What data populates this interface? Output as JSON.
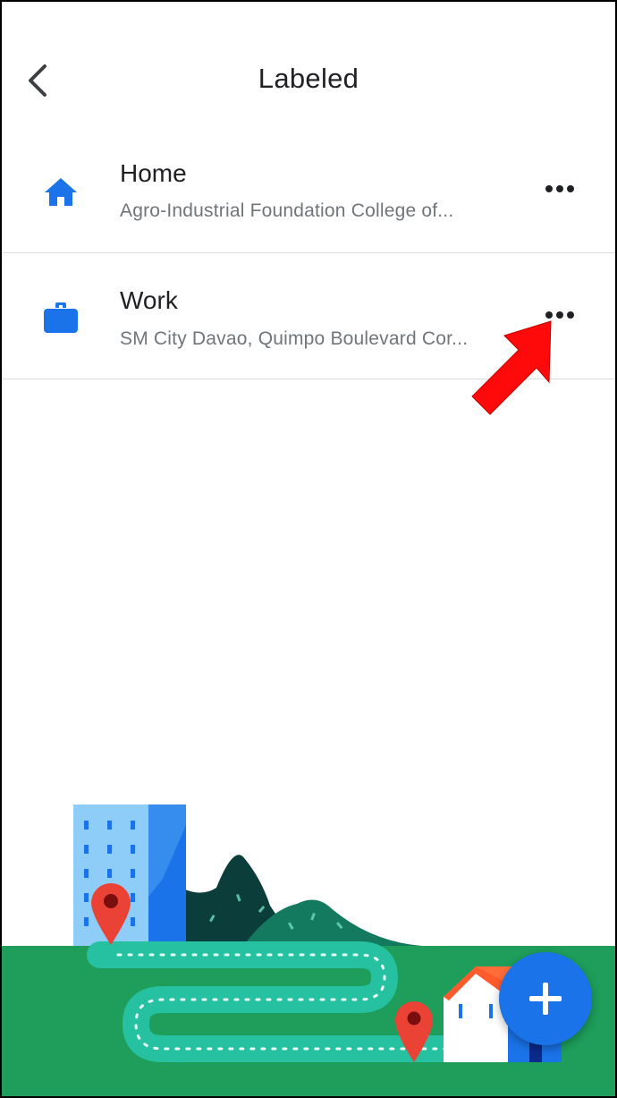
{
  "header": {
    "title": "Labeled",
    "back_icon": "chevron-left-icon"
  },
  "labeled_places": [
    {
      "label": "Home",
      "address": "Agro-Industrial Foundation College of...",
      "icon": "home-icon",
      "more_icon": "more-horizontal-icon"
    },
    {
      "label": "Work",
      "address": "SM City Davao, Quimpo Boulevard Cor...",
      "icon": "briefcase-icon",
      "more_icon": "more-horizontal-icon"
    }
  ],
  "annotation": {
    "icon": "red-arrow-pointer",
    "color": "#ff0000"
  },
  "fab": {
    "icon": "plus-icon",
    "color": "#1a73e8"
  },
  "colors": {
    "accent": "#1a73e8",
    "ground": "#1e9e5a",
    "path": "#26c1a0"
  }
}
